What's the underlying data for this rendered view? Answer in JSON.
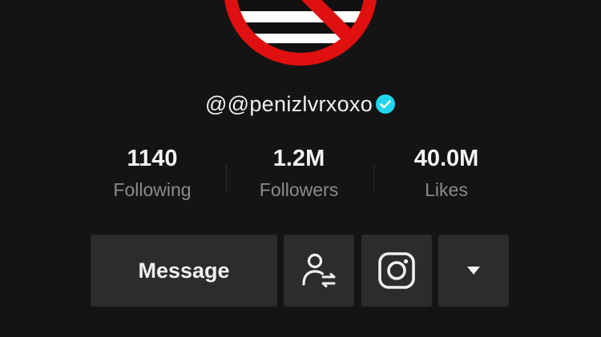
{
  "profile": {
    "username": "@@penizlvrxoxo",
    "verified": true,
    "avatar": {
      "icon": "no-symbol-over-striped-flag",
      "ring_color": "#e01010",
      "stripe_colors": [
        "#2b5fd9",
        "#111111",
        "#ffffff"
      ]
    }
  },
  "stats": [
    {
      "value": "1140",
      "label": "Following"
    },
    {
      "value": "1.2M",
      "label": "Followers"
    },
    {
      "value": "40.0M",
      "label": "Likes"
    }
  ],
  "actions": {
    "message_label": "Message",
    "follow_icon": "person-swap-icon",
    "instagram_icon": "instagram-icon",
    "more_icon": "dropdown-arrow-icon"
  },
  "colors": {
    "background": "#141414",
    "button_bg": "#2c2c2c",
    "verified": "#20d5ec",
    "label_text": "#8a8a8a"
  }
}
